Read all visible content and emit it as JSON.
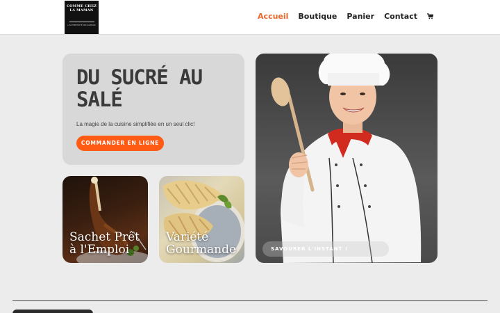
{
  "header": {
    "logo": {
      "line1": "COMME CHEZ LA MAMAN",
      "line2": "L'AUTHENTICITÉ DES SAVEURS"
    },
    "nav": [
      {
        "label": "Accueil",
        "active": true
      },
      {
        "label": "Boutique",
        "active": false
      },
      {
        "label": "Panier",
        "active": false
      },
      {
        "label": "Contact",
        "active": false
      }
    ],
    "cart_icon": "cart-icon",
    "accent_color": "#e8692b"
  },
  "hero": {
    "title": "DU SUCRÉ AU SALÉ",
    "subtitle": "La magie de la cuisine simplifiée en un seul clic!",
    "button_label": "COMMANDER EN LIGNE",
    "button_color": "#ff5b14"
  },
  "tiles": [
    {
      "label": "Sachet Prêt à l'Emploi"
    },
    {
      "label": "Variété Gourmande"
    }
  ],
  "chef": {
    "button_label": "SAVOURER L'INSTANT !"
  }
}
